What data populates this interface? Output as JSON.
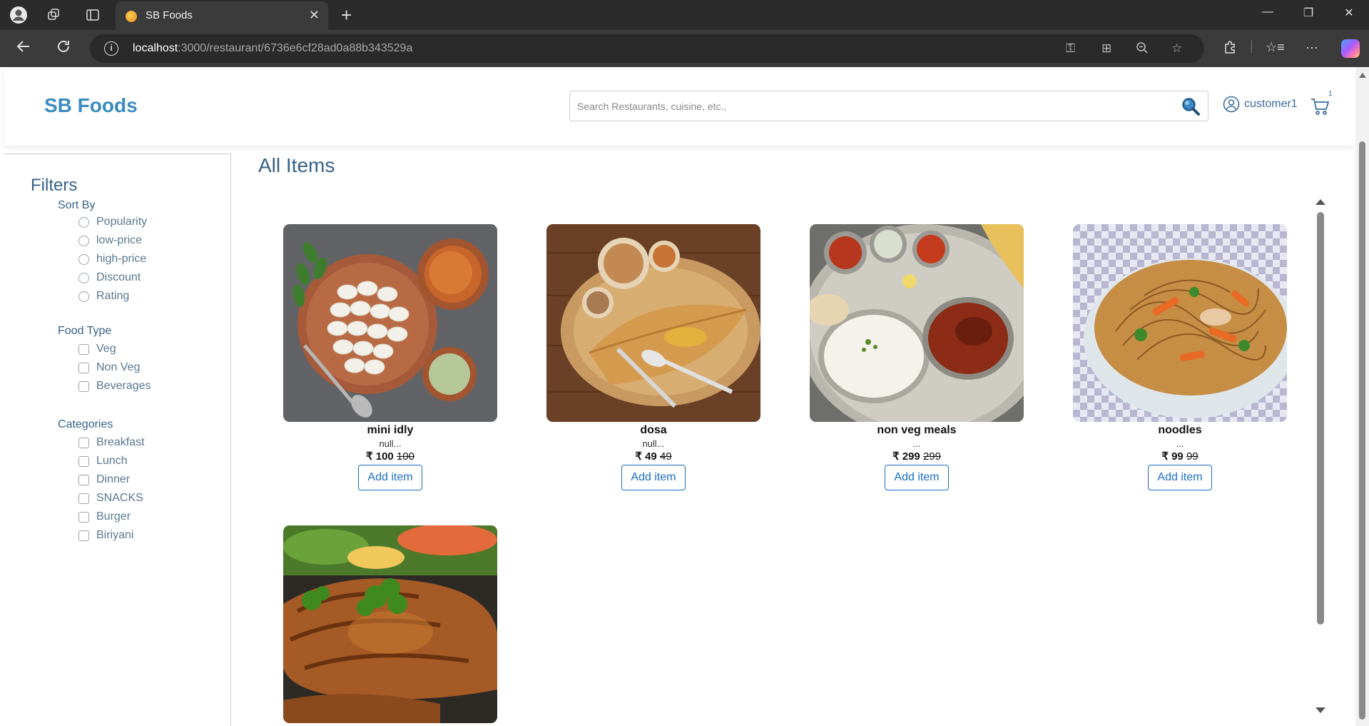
{
  "browser": {
    "tab_title": "SB Foods",
    "url_host": "localhost",
    "url_path": ":3000/restaurant/6736e6cf28ad0a88b343529a"
  },
  "header": {
    "brand": "SB Foods",
    "search_placeholder": "Search Restaurants, cuisine, etc.,",
    "username": "customer1",
    "cart_count": "1"
  },
  "filters": {
    "title": "Filters",
    "sort_by": {
      "title": "Sort By",
      "options": [
        "Popularity",
        "low-price",
        "high-price",
        "Discount",
        "Rating"
      ]
    },
    "food_type": {
      "title": "Food Type",
      "options": [
        "Veg",
        "Non Veg",
        "Beverages"
      ]
    },
    "categories": {
      "title": "Categories",
      "options": [
        "Breakfast",
        "Lunch",
        "Dinner",
        "SNACKS",
        "Burger",
        "Biriyani"
      ]
    }
  },
  "main": {
    "heading": "All Items",
    "items": [
      {
        "name": "mini idly",
        "desc": "null...",
        "price": "₹ 100",
        "old_price": "100",
        "button": "Add item"
      },
      {
        "name": "dosa",
        "desc": "null...",
        "price": "₹ 49",
        "old_price": "49",
        "button": "Add item"
      },
      {
        "name": "non veg meals",
        "desc": "...",
        "price": "₹ 299",
        "old_price": "299",
        "button": "Add item"
      },
      {
        "name": "noodles",
        "desc": "...",
        "price": "₹ 99",
        "old_price": "99",
        "button": "Add item"
      },
      {
        "name": "",
        "desc": "",
        "price": "",
        "old_price": "",
        "button": ""
      }
    ]
  },
  "colors": {
    "brand": "#3a8cc0",
    "heading": "#37628a",
    "button": "#1b6ec2"
  }
}
